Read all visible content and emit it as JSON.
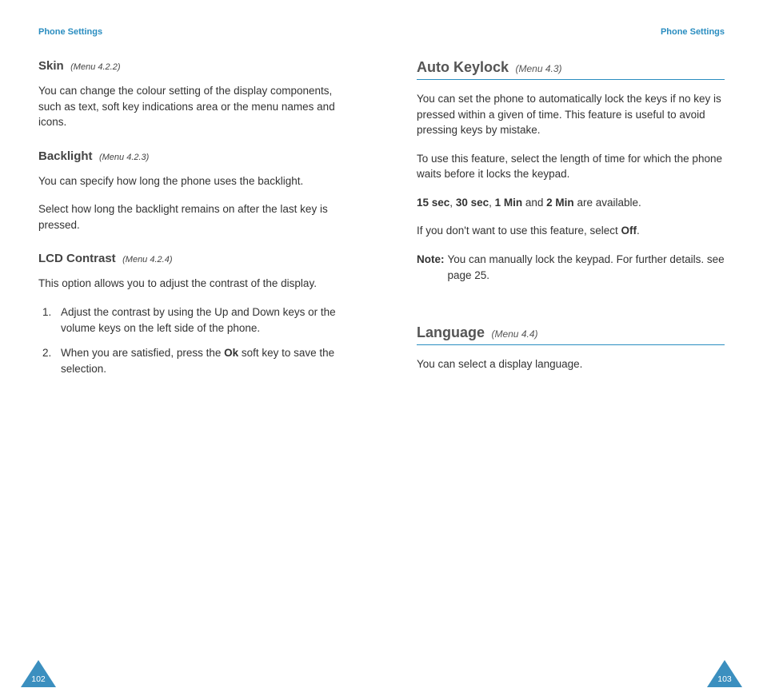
{
  "left": {
    "running_head": "Phone Settings",
    "page_number": "102",
    "skin": {
      "title": "Skin",
      "menu": "(Menu 4.2.2)",
      "para": "You can change the colour setting of the display components, such as text, soft key indications area or the menu names and icons."
    },
    "backlight": {
      "title": "Backlight",
      "menu": "(Menu 4.2.3)",
      "para1": "You can specify how long the phone uses the backlight.",
      "para2": "Select how long the backlight remains on after the last key is pressed."
    },
    "lcd": {
      "title": "LCD Contrast",
      "menu": "(Menu 4.2.4)",
      "para": "This option allows you to adjust the contrast of the display.",
      "step1": "Adjust the contrast by using the Up and Down keys or the volume keys on the left side of the phone.",
      "step2_pre": "When you are satisfied, press the ",
      "step2_bold": "Ok",
      "step2_post": " soft key to save the selection."
    }
  },
  "right": {
    "running_head": "Phone Settings",
    "page_number": "103",
    "autokeylock": {
      "title": "Auto Keylock",
      "menu": "(Menu 4.3)",
      "para1": "You can set the phone to automatically lock the keys if no key is pressed within a given of time. This feature is useful to avoid pressing keys by mistake.",
      "para2": "To use this feature, select the length of time for which the phone waits before it locks the keypad.",
      "opts": {
        "b1": "15 sec",
        "s1": ", ",
        "b2": "30 sec",
        "s2": ", ",
        "b3": "1 Min",
        "s3": " and ",
        "b4": "2 Min",
        "s4": " are available."
      },
      "off_pre": "If you don't want to use this feature, select ",
      "off_bold": "Off",
      "off_post": ".",
      "note_label": "Note",
      "note_colon": ": ",
      "note_text": "You can manually lock the keypad. For further details. see page 25."
    },
    "language": {
      "title": "Language",
      "menu": "(Menu 4.4)",
      "para": "You can select a display language."
    }
  }
}
